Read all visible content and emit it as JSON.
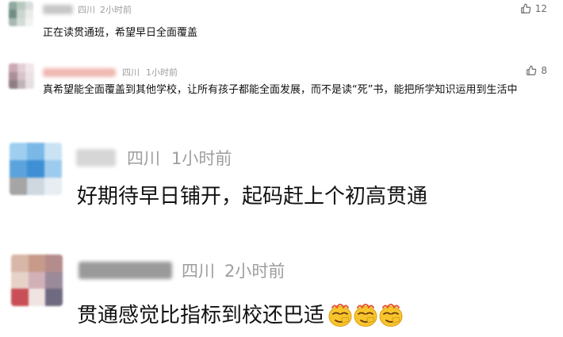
{
  "comments": [
    {
      "location": "四川",
      "time": "2小时前",
      "likes": "12",
      "text": "正在读贯通班，希望早日全面覆盖",
      "avatar_colors": [
        "#8fa8a0",
        "#b7c9bf",
        "#d9dedd",
        "#6f8f86",
        "#ccd6d0",
        "#e8ecea",
        "#a9b8b2",
        "#d4dcd8",
        "#f1f3f2"
      ],
      "name_blur_color": "#c7c7c7"
    },
    {
      "location": "四川",
      "time": "1小时前",
      "likes": "8",
      "text": "真希望能全面覆盖到其他学校，让所有孩子都能全面发展，而不是读“死”书，能把所学知识运用到生活中",
      "avatar_colors": [
        "#c9a9b4",
        "#e3cfd6",
        "#f2e6ea",
        "#a98f9a",
        "#d7c3ca",
        "#ece2e5",
        "#8e7d85",
        "#c0b3b8",
        "#e6e0e2"
      ],
      "name_blur_color": "#f0b8b0"
    },
    {
      "location": "四川",
      "time": "1小时前",
      "text": "好期待早日铺开，起码赶上个初高贯通",
      "avatar_colors": [
        "#9fcff0",
        "#7ab8e6",
        "#c9e3f5",
        "#5aa3dd",
        "#3f8fd4",
        "#9ccbee",
        "#a5a5a5",
        "#cfd8df",
        "#e7edf2"
      ],
      "name_blur_color": "#d6d6d6"
    },
    {
      "location": "四川",
      "time": "2小时前",
      "text": "贯通感觉比指标到校还巴适",
      "emoji": "awesome-emoji",
      "avatar_colors": [
        "#d8b7a8",
        "#c79a8a",
        "#b58c8c",
        "#e6d2c8",
        "#d1b0b8",
        "#9b8a9a",
        "#c94e55",
        "#f0e4e2",
        "#6f6a80"
      ],
      "name_blur_color": "#9a9a9a"
    }
  ]
}
